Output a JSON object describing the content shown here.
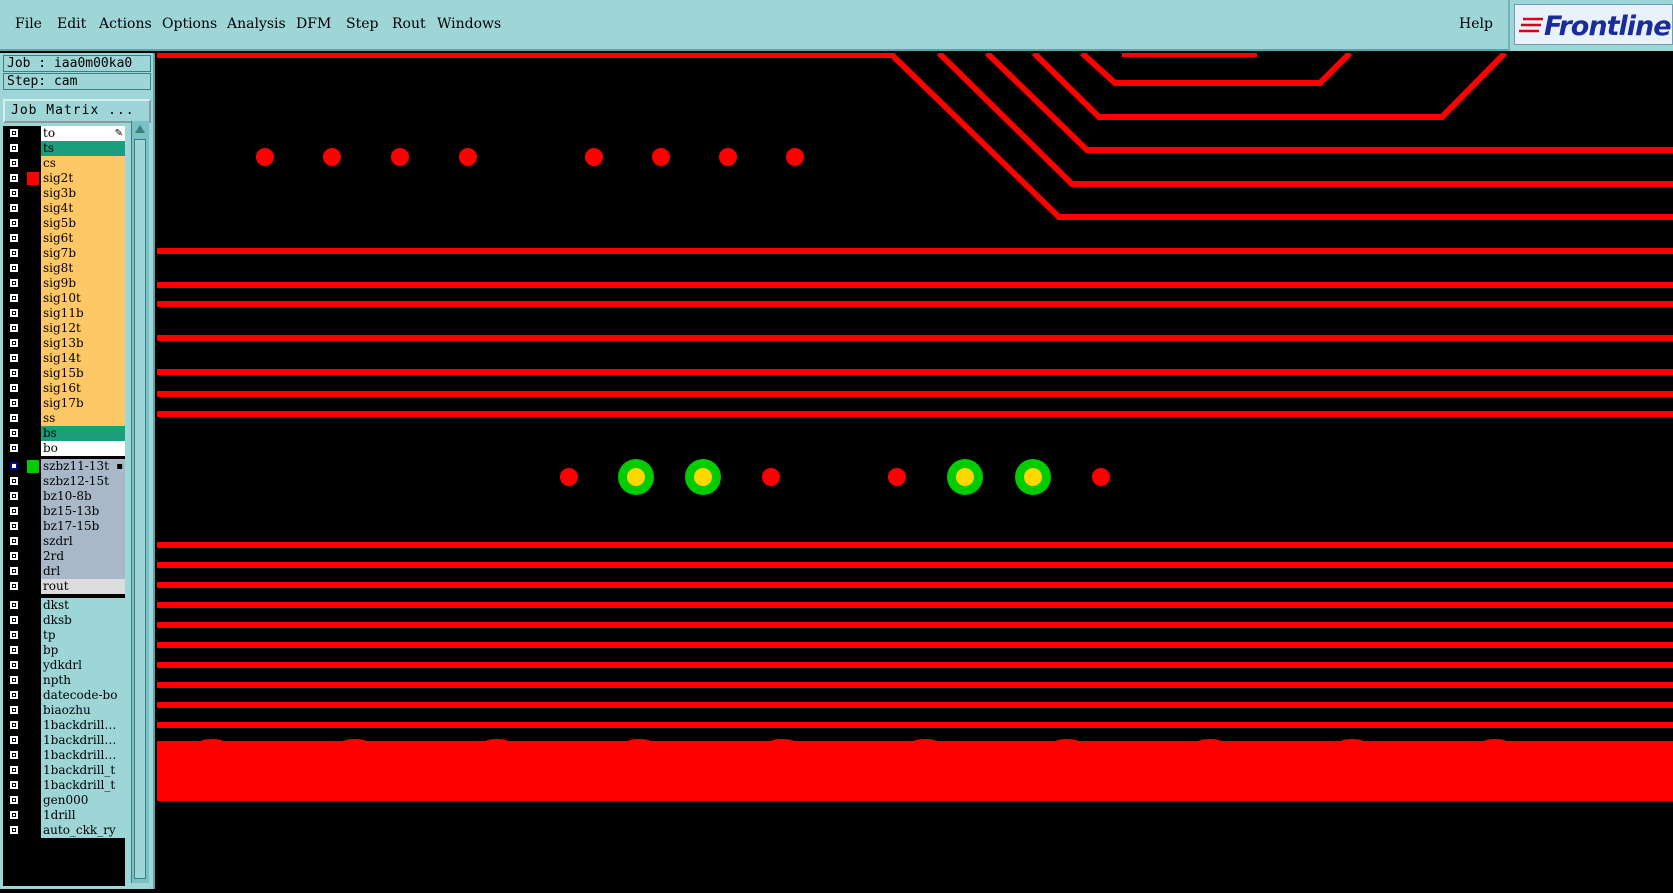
{
  "menubar": {
    "items": [
      {
        "label": "File"
      },
      {
        "label": "Edit"
      },
      {
        "label": "Actions"
      },
      {
        "label": "Options"
      },
      {
        "label": "Analysis"
      },
      {
        "label": "DFM"
      },
      {
        "label": "Step"
      },
      {
        "label": "Rout"
      },
      {
        "label": "Windows"
      }
    ],
    "help_label": "Help"
  },
  "logo": {
    "text": "Frontline"
  },
  "job_label": "Job : iaa0m00ka0",
  "step_label": "Step: cam",
  "job_matrix_label": "Job Matrix ...",
  "layers": [
    {
      "name": "to",
      "bg": "#ffffff",
      "marker": "✎"
    },
    {
      "name": "ts",
      "bg": "#1a9e7e"
    },
    {
      "name": "cs",
      "bg": "#ffc866"
    },
    {
      "name": "sig2t",
      "bg": "#ffc866",
      "swatch": "#ff0000"
    },
    {
      "name": "sig3b",
      "bg": "#ffc866"
    },
    {
      "name": "sig4t",
      "bg": "#ffc866"
    },
    {
      "name": "sig5b",
      "bg": "#ffc866"
    },
    {
      "name": "sig6t",
      "bg": "#ffc866"
    },
    {
      "name": "sig7b",
      "bg": "#ffc866"
    },
    {
      "name": "sig8t",
      "bg": "#ffc866"
    },
    {
      "name": "sig9b",
      "bg": "#ffc866"
    },
    {
      "name": "sig10t",
      "bg": "#ffc866"
    },
    {
      "name": "sig11b",
      "bg": "#ffc866"
    },
    {
      "name": "sig12t",
      "bg": "#ffc866"
    },
    {
      "name": "sig13b",
      "bg": "#ffc866"
    },
    {
      "name": "sig14t",
      "bg": "#ffc866"
    },
    {
      "name": "sig15b",
      "bg": "#ffc866"
    },
    {
      "name": "sig16t",
      "bg": "#ffc866"
    },
    {
      "name": "sig17b",
      "bg": "#ffc866"
    },
    {
      "name": "ss",
      "bg": "#ffc866"
    },
    {
      "name": "bs",
      "bg": "#1a9e7e"
    },
    {
      "name": "bo",
      "bg": "#ffffff"
    },
    {
      "name": "szbz11-13t",
      "bg": "#a8b8c8",
      "swatch": "#00cc00",
      "selected": true,
      "marker": "▪"
    },
    {
      "name": "szbz12-15t",
      "bg": "#a8b8c8"
    },
    {
      "name": "bz10-8b",
      "bg": "#a8b8c8"
    },
    {
      "name": "bz15-13b",
      "bg": "#a8b8c8"
    },
    {
      "name": "bz17-15b",
      "bg": "#a8b8c8"
    },
    {
      "name": "szdrl",
      "bg": "#a8b8c8"
    },
    {
      "name": "2rd",
      "bg": "#a8b8c8"
    },
    {
      "name": "drl",
      "bg": "#a8b8c8"
    },
    {
      "name": "rout",
      "bg": "#dcdcdc"
    },
    {
      "name": "dkst",
      "bg": "#9ed6d8"
    },
    {
      "name": "dksb",
      "bg": "#9ed6d8"
    },
    {
      "name": "tp",
      "bg": "#9ed6d8"
    },
    {
      "name": "bp",
      "bg": "#9ed6d8"
    },
    {
      "name": "ydkdrl",
      "bg": "#9ed6d8"
    },
    {
      "name": "npth",
      "bg": "#9ed6d8"
    },
    {
      "name": "datecode-bo",
      "bg": "#9ed6d8"
    },
    {
      "name": "biaozhu",
      "bg": "#9ed6d8"
    },
    {
      "name": "1backdrill…",
      "bg": "#9ed6d8"
    },
    {
      "name": "1backdrill…",
      "bg": "#9ed6d8"
    },
    {
      "name": "1backdrill…",
      "bg": "#9ed6d8"
    },
    {
      "name": "1backdrill_t",
      "bg": "#9ed6d8"
    },
    {
      "name": "1backdrill_t",
      "bg": "#9ed6d8"
    },
    {
      "name": "gen000",
      "bg": "#9ed6d8"
    },
    {
      "name": "1drill",
      "bg": "#9ed6d8"
    },
    {
      "name": "auto_ckk_ry",
      "bg": "#9ed6d8"
    }
  ],
  "colors": {
    "trace": "#ff0000",
    "pad": "#ff0000",
    "via_ring": "#00cc00",
    "via_center": "#ffd700",
    "background": "#000000"
  }
}
